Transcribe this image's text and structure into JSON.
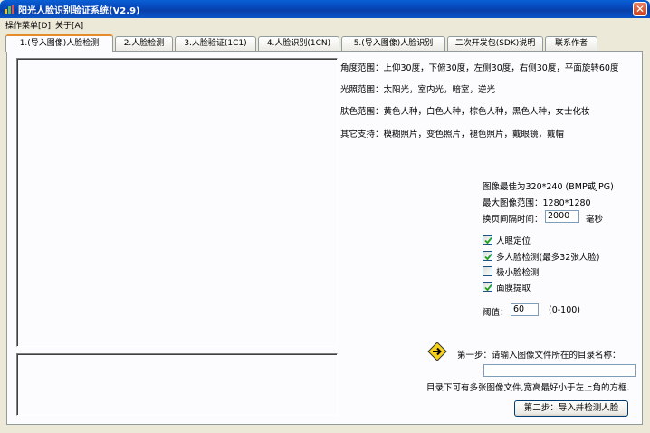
{
  "window": {
    "title": "阳光人脸识别验证系统(V2.9)",
    "close_glyph": "✕"
  },
  "menu": [
    "操作菜单[D]",
    "关于[A]"
  ],
  "tabs": [
    "1.(导入图像)人脸检测",
    "2.人脸检测",
    "3.人脸验证(1C1)",
    "4.人脸识别(1CN)",
    "5.(导入图像)人脸识别",
    "二次开发包(SDK)说明",
    "联系作者"
  ],
  "active_tab": 0,
  "info": {
    "angle": "角度范围：上仰30度，下俯30度，左侧30度，右侧30度，平面旋转60度",
    "lighting": "光照范围：太阳光，室内光，暗室，逆光",
    "skin": "肤色范围：黄色人种，白色人种，棕色人种，黑色人种，女士化妆",
    "other": "其它支持：模糊照片，变色照片，褪色照片，戴眼镜，戴帽"
  },
  "settings": {
    "best_size": "图像最佳为320*240 (BMP或JPG)",
    "max_size": "最大图像范围：1280*1280",
    "interval_label": "换页间隔时间：",
    "interval_value": "2000",
    "interval_unit": "毫秒"
  },
  "options": [
    {
      "label": "人眼定位",
      "checked": true
    },
    {
      "label": "多人脸检测(最多32张人脸)",
      "checked": true
    },
    {
      "label": "极小脸检测",
      "checked": false
    },
    {
      "label": "面膜提取",
      "checked": true
    }
  ],
  "threshold": {
    "label": "阈值：",
    "value": "60",
    "range": "(0-100)"
  },
  "step1": {
    "label": "第一步：请输入图像文件所在的目录名称：",
    "path_value": ""
  },
  "hint": "目录下可有多张图像文件,宽高最好小于左上角的方框.",
  "step2_button": "第二步：导入并检测人脸",
  "colors": {
    "title_bar": "#0a5fd6",
    "active_tab_accent": "#e68b2c",
    "arrow_sign": "#f6d21c"
  },
  "icons": {
    "app": "app-icon",
    "close": "close-icon",
    "next_step": "arrow-sign-icon"
  }
}
